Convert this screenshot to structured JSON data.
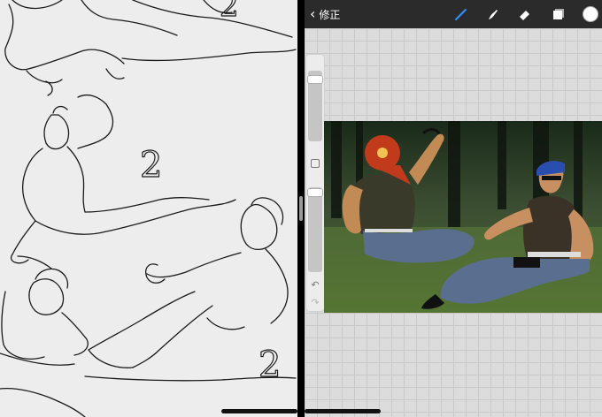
{
  "toolbar": {
    "back_label": "修正",
    "back_icon": "chevron-left-icon",
    "tools": [
      "brush-icon",
      "smudge-icon",
      "eraser-icon",
      "layers-icon"
    ],
    "current_color": "#ffffff"
  },
  "sketch": {
    "marks": [
      "2",
      "2",
      "2"
    ]
  },
  "colors": {
    "toolbar_bg": "#2b2b2b",
    "accent": "#2f8cff"
  }
}
